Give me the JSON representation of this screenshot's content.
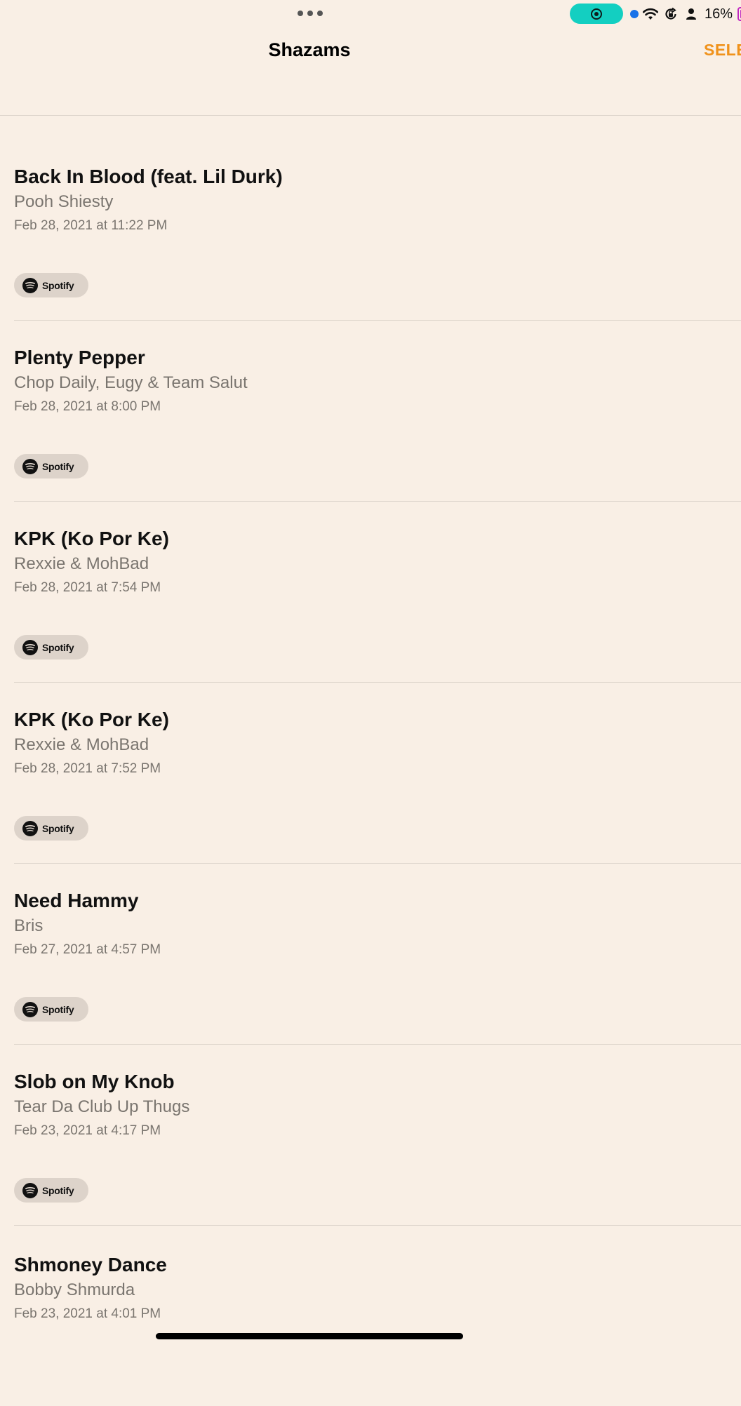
{
  "status_bar": {
    "battery_percent": "16%",
    "accent_screen_record": "#13cfc1",
    "icons": [
      "multitask-dots-icon",
      "screen-record-icon",
      "location-dot-icon",
      "wifi-icon",
      "rotation-lock-icon",
      "person-icon",
      "battery-icon"
    ]
  },
  "header": {
    "title": "Shazams",
    "select_label": "SELECT",
    "accent_color": "#f0921b"
  },
  "shazams": [
    {
      "title": "Back In Blood (feat. Lil Durk)",
      "artist": "Pooh Shiesty",
      "date": "Feb 28, 2021 at 11:22 PM",
      "service": "Spotify"
    },
    {
      "title": "Plenty Pepper",
      "artist": "Chop Daily, Eugy & Team Salut",
      "date": "Feb 28, 2021 at 8:00 PM",
      "service": "Spotify"
    },
    {
      "title": "KPK (Ko Por Ke)",
      "artist": "Rexxie & MohBad",
      "date": "Feb 28, 2021 at 7:54 PM",
      "service": "Spotify"
    },
    {
      "title": "KPK (Ko Por Ke)",
      "artist": "Rexxie & MohBad",
      "date": "Feb 28, 2021 at 7:52 PM",
      "service": "Spotify"
    },
    {
      "title": "Need Hammy",
      "artist": "Bris",
      "date": "Feb 27, 2021 at 4:57 PM",
      "service": "Spotify"
    },
    {
      "title": "Slob on My Knob",
      "artist": "Tear Da Club Up Thugs",
      "date": "Feb 23, 2021 at 4:17 PM",
      "service": "Spotify"
    },
    {
      "title": "Shmoney Dance",
      "artist": "Bobby Shmurda",
      "date": "Feb 23, 2021 at 4:01 PM"
    }
  ]
}
